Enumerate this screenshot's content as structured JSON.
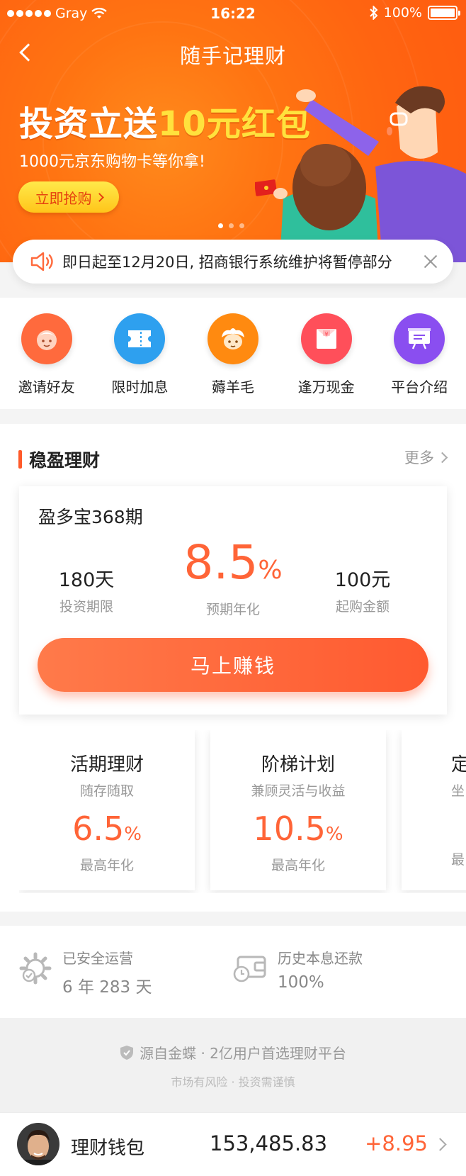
{
  "statusbar": {
    "carrier": "Gray",
    "time": "16:22",
    "battery": "100%"
  },
  "nav": {
    "title": "随手记理财"
  },
  "banner": {
    "title_a": "投资立送",
    "title_b": "10元红包",
    "subtitle": "1000元京东购物卡等你拿!",
    "button": "立即抢购",
    "slides": 3,
    "active_slide": 1
  },
  "notice": {
    "text": "即日起至12月20日, 招商银行系统维护将暂停部分"
  },
  "quick_menu": [
    {
      "label": "邀请好友",
      "icon": "invite-friend-icon",
      "color": "#ff6a3d"
    },
    {
      "label": "限时加息",
      "icon": "ticket-icon",
      "color": "#2ea0ef"
    },
    {
      "label": "薅羊毛",
      "icon": "sheep-icon",
      "color": "#ff8a10"
    },
    {
      "label": "逢万现金",
      "icon": "red-envelope-icon",
      "color": "#ff4f5a"
    },
    {
      "label": "平台介绍",
      "icon": "board-icon",
      "color": "#8a4ef0"
    }
  ],
  "section": {
    "title": "稳盈理财",
    "more": "更多",
    "product": {
      "name": "盈多宝368期",
      "term_value": "180天",
      "term_label": "投资期限",
      "rate_value": "8.5",
      "rate_unit": "%",
      "rate_label": "预期年化",
      "min_value": "100元",
      "min_label": "起购金额",
      "button": "马上赚钱"
    },
    "cards": [
      {
        "title": "活期理财",
        "subtitle": "随存随取",
        "rate": "6.5",
        "unit": "%",
        "caption": "最高年化"
      },
      {
        "title": "阶梯计划",
        "subtitle": "兼顾灵活与收益",
        "rate": "10.5",
        "unit": "%",
        "caption": "最高年化"
      },
      {
        "title": "定",
        "subtitle": "坐",
        "rate": "",
        "unit": "",
        "caption": "最"
      }
    ]
  },
  "safety": {
    "ops_label": "已安全运营",
    "ops_value": "6 年 283 天",
    "repay_label": "历史本息还款",
    "repay_value": "100%"
  },
  "footer": {
    "line1": "源自金蝶 · 2亿用户首选理财平台",
    "line2": "市场有风险 · 投资需谨慎"
  },
  "wallet": {
    "label": "理财钱包",
    "balance": "153,485.83",
    "change": "+8.95"
  },
  "colors": {
    "accent": "#ff6437",
    "banner": "#ff6a12",
    "highlight": "#ffe23d"
  }
}
